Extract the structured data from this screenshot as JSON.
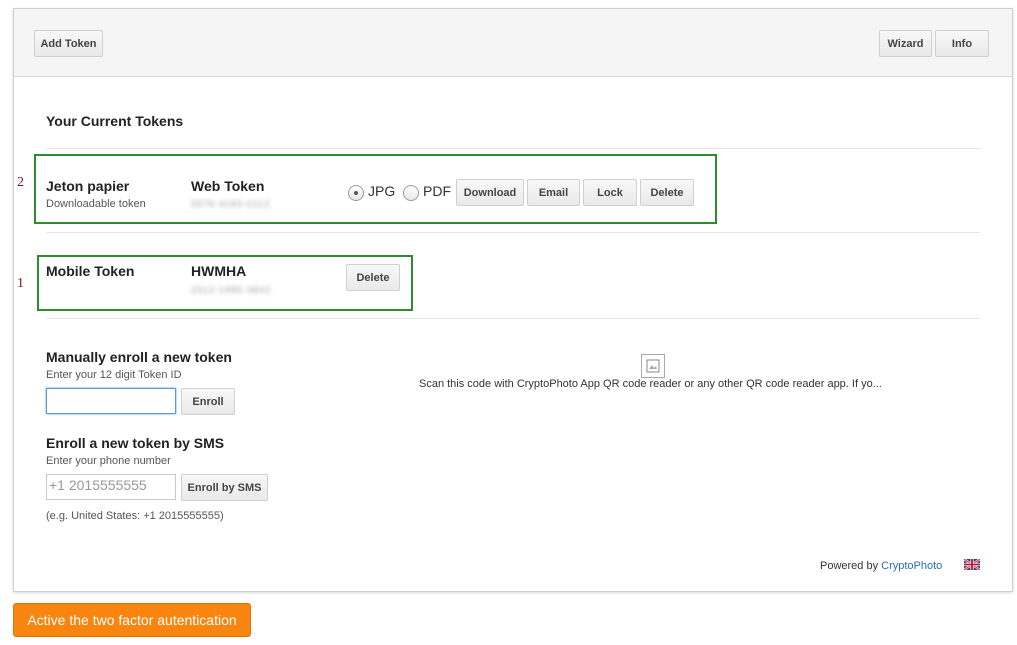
{
  "toolbar": {
    "add_token_label": "Add Token",
    "wizard_label": "Wizard",
    "info_label": "Info"
  },
  "tokens_section": {
    "title": "Your Current Tokens",
    "tokens": [
      {
        "marker": "2",
        "name": "Jeton papier",
        "subtitle": "Downloadable token",
        "type": "Web Token",
        "id_blurred": "5576-4183-0112",
        "format_options": [
          "JPG",
          "PDF"
        ],
        "selected_format": "JPG",
        "actions": [
          "Download",
          "Email",
          "Lock",
          "Delete"
        ]
      },
      {
        "marker": "1",
        "name": "Mobile Token",
        "type": "HWMHA",
        "id_blurred": "2512-1985-3843",
        "actions": [
          "Delete"
        ]
      }
    ]
  },
  "manual_enroll": {
    "title": "Manually enroll a new token",
    "hint": "Enter your 12 digit Token ID",
    "input_value": "",
    "button_label": "Enroll"
  },
  "sms_enroll": {
    "title": "Enroll a new token by SMS",
    "hint": "Enter your phone number",
    "placeholder": "+1 2015555555",
    "button_label": "Enroll by SMS",
    "example": "(e.g. United States: +1 2015555555)"
  },
  "qr": {
    "caption": "Scan this code with CryptoPhoto App QR code reader or any other QR code reader app. If yo..."
  },
  "footer": {
    "powered_by": "Powered by",
    "brand": "CryptoPhoto",
    "flag_icon": "uk-flag-icon"
  },
  "cta": {
    "label": "Active the two factor autentication",
    "color": "#f7850f"
  }
}
